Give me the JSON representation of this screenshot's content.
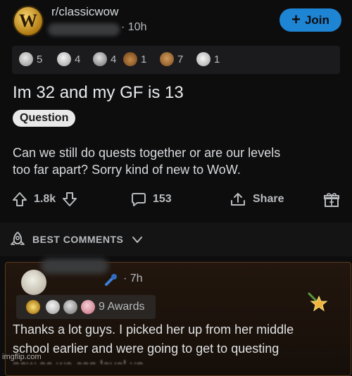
{
  "post": {
    "subreddit": "r/classicwow",
    "subreddit_icon_letter": "W",
    "time": "· 10h",
    "join_label": "Join",
    "awards": [
      {
        "icon": "wholesome-seal-icon",
        "count": "5"
      },
      {
        "icon": "laughing-face-icon",
        "count": "4"
      },
      {
        "icon": "silver-award-icon",
        "count": "4"
      },
      {
        "icon": "poop-award-icon",
        "count": "1"
      },
      {
        "icon": "facepalm-award-icon",
        "count": "7"
      },
      {
        "icon": "helpful-award-icon",
        "count": "1"
      }
    ],
    "title": "Im 32 and my GF is 13",
    "flair": "Question",
    "body_line1": "Can we still do quests together or are our levels",
    "body_line2": "too far apart? Sorry kind of new to WoW.",
    "upvotes": "1.8k",
    "comments": "153",
    "share_label": "Share"
  },
  "comments_section": {
    "sort_label": "BEST COMMENTS"
  },
  "top_comment": {
    "time": "· 7h",
    "awards_label": "9 Awards",
    "body_line1": "Thanks a lot guys. I picked her up from her middle",
    "body_line2": "school earlier and were going to get to questing",
    "body_line3": "now so we can level up…"
  },
  "watermark": "imgflip.com",
  "colors": {
    "background": "#0d0d0e",
    "accent": "#1e84d4",
    "comment_highlight": "#22160e"
  }
}
